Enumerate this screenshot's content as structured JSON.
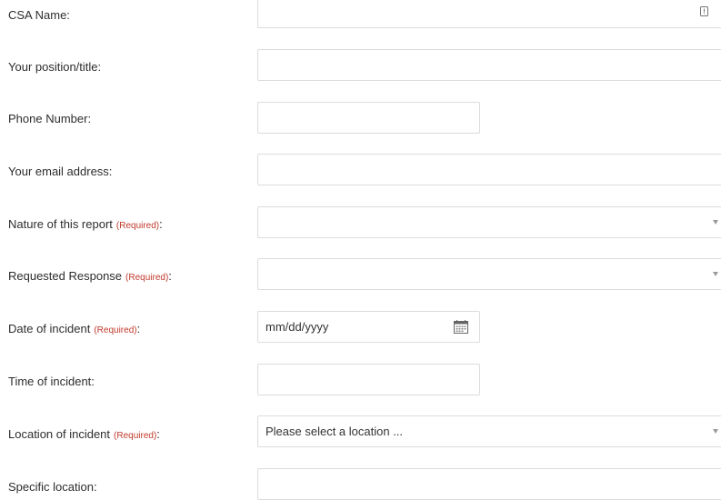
{
  "form": {
    "fields": [
      {
        "label": "CSA Name:",
        "required": false,
        "type": "text",
        "value": ""
      },
      {
        "label": "Your position/title:",
        "required": false,
        "type": "text",
        "value": ""
      },
      {
        "label": "Phone Number:",
        "required": false,
        "type": "text",
        "value": ""
      },
      {
        "label": "Your email address:",
        "required": false,
        "type": "text",
        "value": ""
      },
      {
        "label": "Nature of this report",
        "required": true,
        "type": "select",
        "value": ""
      },
      {
        "label": "Requested Response",
        "required": true,
        "type": "select",
        "value": ""
      },
      {
        "label": "Date of incident",
        "required": true,
        "type": "date",
        "value": "mm/dd/yyyy"
      },
      {
        "label": "Time of incident:",
        "required": false,
        "type": "text",
        "value": ""
      },
      {
        "label": "Location of incident",
        "required": true,
        "type": "select",
        "value": "Please select a location ..."
      },
      {
        "label": "Specific location:",
        "required": false,
        "type": "text",
        "value": ""
      }
    ],
    "required_text": "(Required)",
    "colon": ":"
  },
  "icons": {
    "autofill": "autofill-contact-icon",
    "select_caret": "chevron-down-icon",
    "calendar": "calendar-icon"
  },
  "colors": {
    "required": "#c0392b",
    "field_border": "#dcdcdc",
    "label_text": "#2d2d2d"
  }
}
